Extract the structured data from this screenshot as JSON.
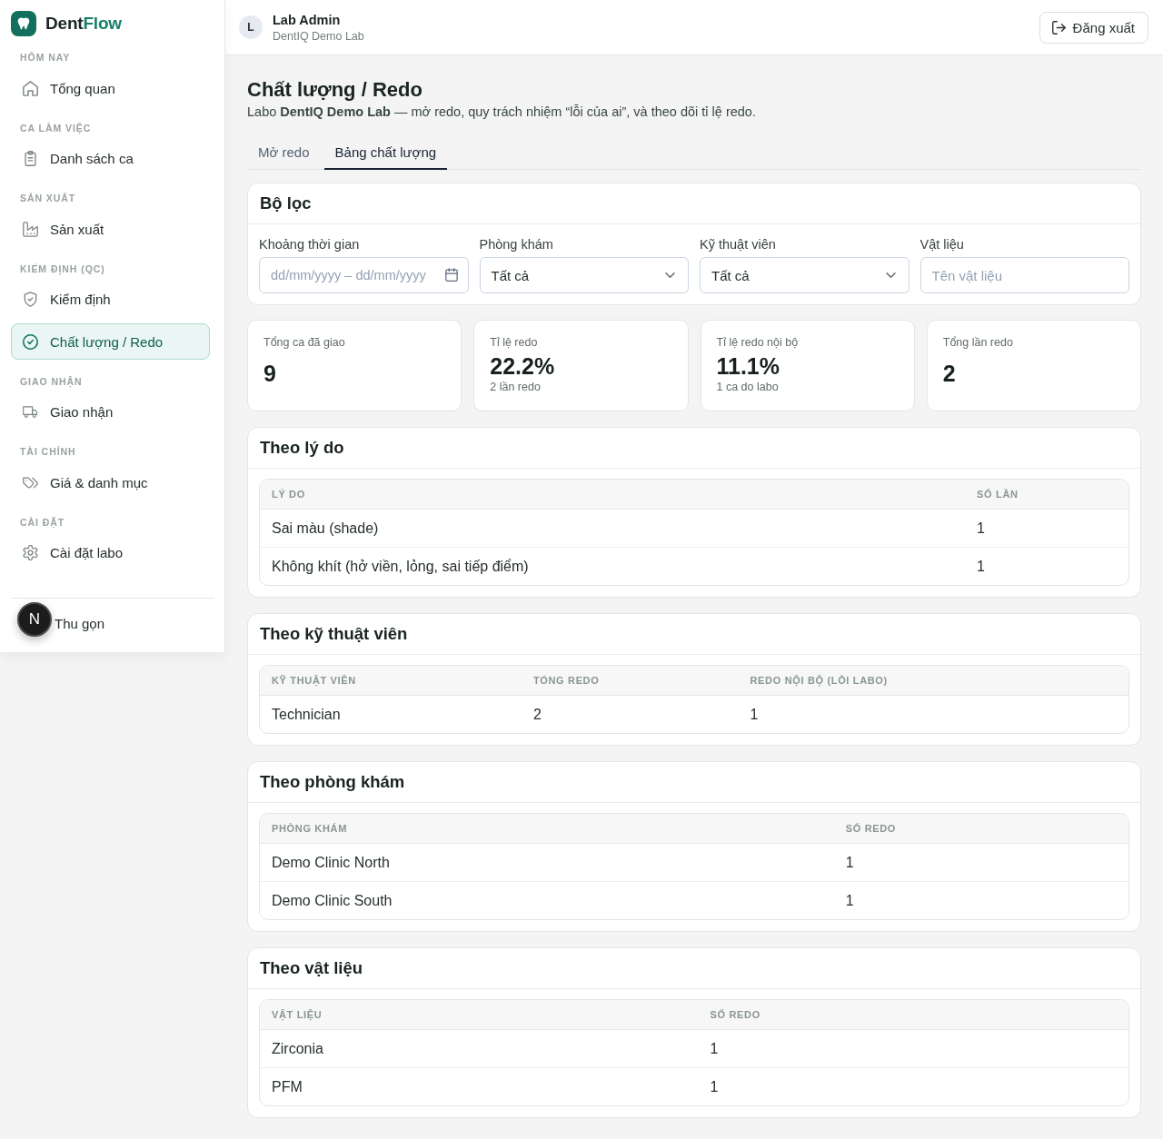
{
  "sidebar": {
    "brand": {
      "name": "Dent",
      "accent": "Flow"
    },
    "sections": [
      {
        "heading": "HÔM NAY",
        "items": [
          {
            "label": "Tổng quan",
            "selected": false
          }
        ]
      },
      {
        "heading": "CA LÀM VIỆC",
        "items": [
          {
            "label": "Danh sách ca",
            "selected": false
          }
        ]
      },
      {
        "heading": "SẢN XUẤT",
        "items": [
          {
            "label": "Sản xuất",
            "selected": false
          }
        ]
      },
      {
        "heading": "KIỂM ĐỊNH (QC)",
        "items": [
          {
            "label": "Kiểm định",
            "selected": false
          },
          {
            "label": "Chất lượng / Redo",
            "selected": true
          }
        ]
      },
      {
        "heading": "GIAO NHẬN",
        "items": [
          {
            "label": "Giao nhận",
            "selected": false
          }
        ]
      },
      {
        "heading": "TÀI CHÍNH",
        "items": [
          {
            "label": "Giá & danh mục",
            "selected": false
          }
        ]
      },
      {
        "heading": "CÀI ĐẶT",
        "items": [
          {
            "label": "Cài đặt labo",
            "selected": false
          }
        ]
      }
    ],
    "collapse": {
      "label": "Thu gọn"
    },
    "floating_badge": {
      "label": "N"
    }
  },
  "top_bar": {
    "user": {
      "initial": "L",
      "name": "Lab Admin",
      "org": "DentIQ Demo Lab"
    },
    "logout_button": {
      "label": "Đăng xuất"
    }
  },
  "page": {
    "title": "Chất lượng / Redo",
    "subtitle": "Labo **DentIQ Demo Lab** — mở redo, quy trách nhiệm “lỗi của ai”, và theo dõi tỉ lệ redo."
  },
  "tabs": [
    {
      "label": "Mở redo",
      "selected": false
    },
    {
      "label": "Bảng chất lượng",
      "selected": true
    }
  ],
  "filters": {
    "title": "Bộ lọc",
    "fields": [
      {
        "kind": "date_range",
        "label": "Khoảng thời gian",
        "placeholder": "dd/mm/yyyy – dd/mm/yyyy"
      },
      {
        "kind": "select",
        "label": "Phòng khám",
        "value": "Tất cả"
      },
      {
        "kind": "select",
        "label": "Kỹ thuật viên",
        "value": "Tất cả"
      },
      {
        "kind": "text",
        "label": "Vật liệu",
        "placeholder": "Tên vật liệu"
      }
    ]
  },
  "stats": [
    {
      "label": "Tổng ca đã giao",
      "value": "9"
    },
    {
      "label": "Tỉ lệ redo",
      "value": "22.2%",
      "note": "2 lần redo"
    },
    {
      "label": "Tỉ lệ redo nội bộ",
      "value": "11.1%",
      "note": "1 ca do labo"
    },
    {
      "label": "Tổng lần redo",
      "value": "2"
    }
  ],
  "sections": [
    {
      "title": "Theo lý do",
      "table": {
        "columns": [
          "LÝ DO",
          "SỐ LẦN"
        ],
        "rows": [
          [
            "Sai màu (shade)",
            "1"
          ],
          [
            "Không khít (hở viền, lỏng, sai tiếp điểm)",
            "1"
          ]
        ]
      }
    },
    {
      "title": "Theo kỹ thuật viên",
      "table": {
        "columns": [
          "KỸ THUẬT VIÊN",
          "TỔNG REDO",
          "REDO NỘI BỘ (LỖI LABO)"
        ],
        "rows": [
          [
            "Technician",
            "2",
            "1"
          ]
        ]
      }
    },
    {
      "title": "Theo phòng khám",
      "table": {
        "columns": [
          "PHÒNG KHÁM",
          "SỐ REDO"
        ],
        "rows": [
          [
            "Demo Clinic North",
            "1"
          ],
          [
            "Demo Clinic South",
            "1"
          ]
        ]
      }
    },
    {
      "title": "Theo vật liệu",
      "table": {
        "columns": [
          "VẬT LIỆU",
          "SỐ REDO"
        ],
        "rows": [
          [
            "Zirconia",
            "1"
          ],
          [
            "PFM",
            "1"
          ]
        ]
      }
    }
  ]
}
